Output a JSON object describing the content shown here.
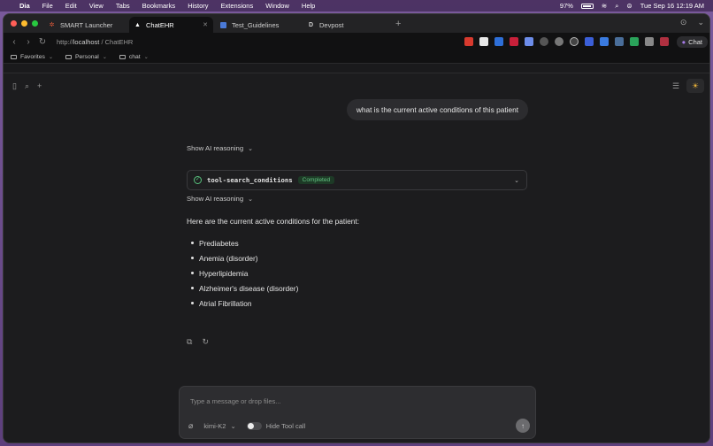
{
  "menubar": {
    "items": [
      "Dia",
      "File",
      "Edit",
      "View",
      "Tabs",
      "Bookmarks",
      "History",
      "Extensions",
      "Window",
      "Help"
    ],
    "battery": "97%",
    "datetime": "Tue Sep 16  12:19 AM"
  },
  "tabs": [
    {
      "label": "SMART Launcher",
      "icon": "app-icon"
    },
    {
      "label": "ChatEHR",
      "icon": "triangle-icon",
      "active": true
    },
    {
      "label": "Test_Guidelines",
      "icon": "doc-icon"
    },
    {
      "label": "Devpost",
      "icon": "d-icon"
    }
  ],
  "address": {
    "prefix": "http://",
    "host": "localhost",
    "path": " / ChatEHR"
  },
  "chat_button": "Chat",
  "bookmarks": [
    "Favorites",
    "Personal",
    "chat"
  ],
  "conversation": {
    "user_message": "what is the current active conditions of this patient",
    "reasoning_1": "Show AI reasoning",
    "tool_name": "tool-search_conditions",
    "tool_status": "Completed",
    "reasoning_2": "Show AI reasoning",
    "answer_intro": "Here are the current active conditions for the patient:",
    "conditions": [
      "Prediabetes",
      "Anemia (disorder)",
      "Hyperlipidemia",
      "Alzheimer's disease (disorder)",
      "Atrial Fibrillation"
    ]
  },
  "composer": {
    "placeholder": "Type a message or drop files...",
    "model": "kimi-K2",
    "toggle_label": "Hide Tool call"
  },
  "colors": {
    "accent_green": "#58c27d",
    "sun": "#e8b13a",
    "background": "#1c1c1e"
  }
}
